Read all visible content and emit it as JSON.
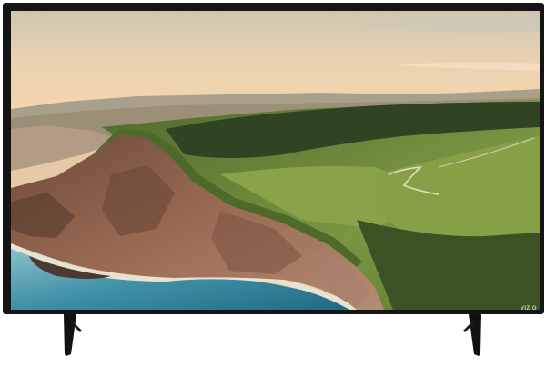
{
  "tv": {
    "brand_logo_text": "VIZIO",
    "bezel_color": "#141414",
    "stand_color": "#111111"
  },
  "screen": {
    "sky_top_color": "#cfc7b0",
    "sky_horizon_color": "#f2d3ad",
    "grass_color": "#6f8a3c",
    "cliff_color": "#8b5e48",
    "sea_color": "#3f8fa6"
  }
}
